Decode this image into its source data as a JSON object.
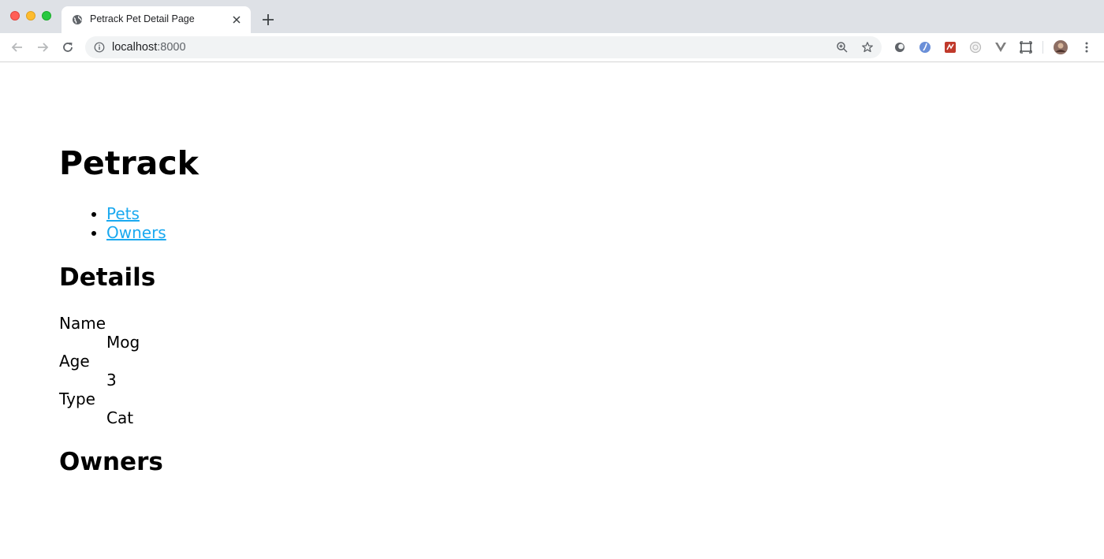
{
  "browser": {
    "tab_title": "Petrack Pet Detail Page",
    "url_host": "localhost",
    "url_port": ":8000",
    "icons": {
      "window_close": "close-window-icon",
      "window_minimize": "minimize-window-icon",
      "window_zoom": "zoom-window-icon",
      "tab_favicon": "globe-icon",
      "tab_close": "close-icon",
      "new_tab": "plus-icon",
      "back": "back-arrow-icon",
      "forward": "forward-arrow-icon",
      "reload": "reload-icon",
      "site_info": "info-icon",
      "zoom": "zoom-in-icon",
      "bookmark": "star-icon",
      "menu": "more-vert-icon"
    }
  },
  "page": {
    "site_title": "Petrack",
    "nav": [
      {
        "label": "Pets"
      },
      {
        "label": "Owners"
      }
    ],
    "details_heading": "Details",
    "details": [
      {
        "term": "Name",
        "value": "Mog"
      },
      {
        "term": "Age",
        "value": "3"
      },
      {
        "term": "Type",
        "value": "Cat"
      }
    ],
    "owners_heading": "Owners"
  },
  "colors": {
    "link": "#1aa9f0",
    "tabstrip": "#dee1e6",
    "omnibox": "#f1f3f4"
  }
}
